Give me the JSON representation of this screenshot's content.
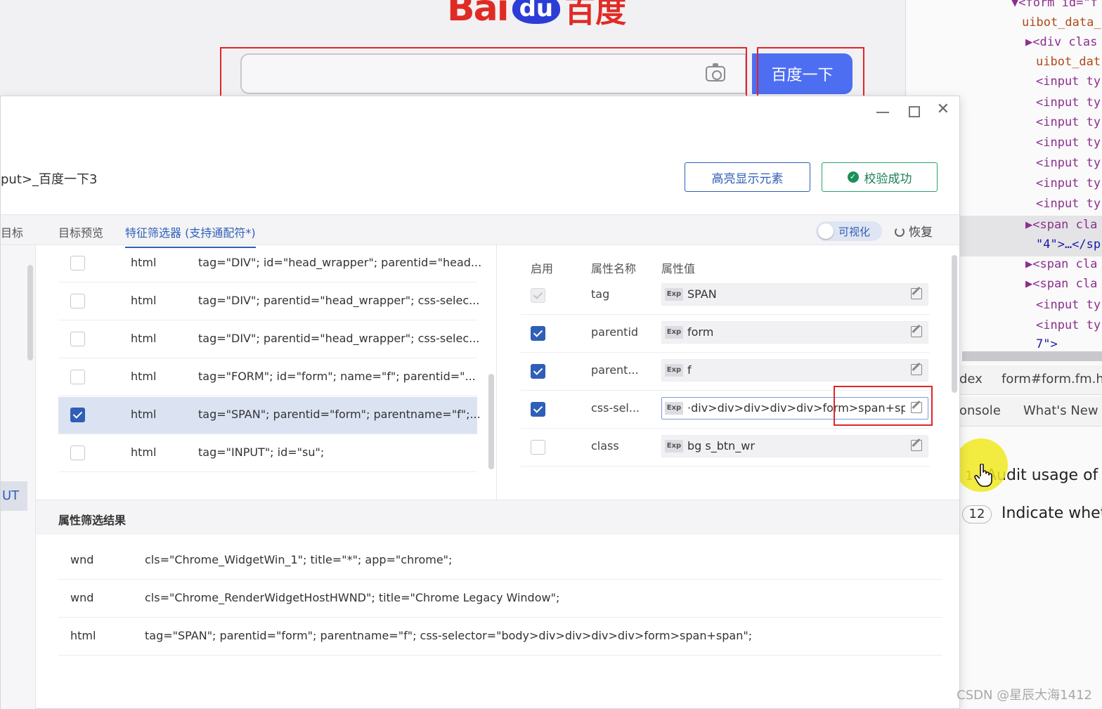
{
  "browser": {
    "logo_bai": "Bai",
    "logo_du": "du",
    "logo_cn": "百度",
    "search_button": "百度一下"
  },
  "devtools": {
    "lines": [
      {
        "text": "▼<form id=\"f",
        "cls": ""
      },
      {
        "text": "uibot_data_",
        "cls": "attr"
      },
      {
        "text": "▶<div clas",
        "cls": ""
      },
      {
        "text": "uibot_dat",
        "cls": "attr"
      },
      {
        "text": "<input ty",
        "cls": ""
      },
      {
        "text": "<input ty",
        "cls": ""
      },
      {
        "text": "<input ty",
        "cls": ""
      },
      {
        "text": "<input ty",
        "cls": ""
      },
      {
        "text": "<input ty",
        "cls": ""
      },
      {
        "text": "<input ty",
        "cls": ""
      },
      {
        "text": "<input ty",
        "cls": ""
      },
      {
        "text": "▶<span cla",
        "cls": ""
      },
      {
        "text": "\"4\">…</sp",
        "cls": "val"
      },
      {
        "text": "▶<span cla",
        "cls": ""
      },
      {
        "text": "▶<span cla",
        "cls": ""
      },
      {
        "text": "<input ty",
        "cls": ""
      },
      {
        "text": "<input ty",
        "cls": ""
      },
      {
        "text": "7\">",
        "cls": "val"
      }
    ],
    "breadcrumb_index": "dex",
    "breadcrumb_form": "form#form.fm.ha",
    "tab_console": "onsole",
    "tab_whats_new": "What's New",
    "issue1_badge": "1",
    "issue1_text": "Audit usage of",
    "issue2_badge": "12",
    "issue2_text": "Indicate wheth"
  },
  "dialog": {
    "breadcrumb": "put>_百度一下3",
    "highlight_button": "高亮显示元素",
    "verify_button": "校验成功",
    "tabs": {
      "target": "目标",
      "preview": "目标预览",
      "filter": "特征筛选器 (支持通配符*)"
    },
    "visualize_label": "可视化",
    "restore_label": "恢复",
    "ut_label": "UT",
    "element_list": [
      {
        "type": "html",
        "desc": "tag=\"DIV\"; id=\"head_wrapper\"; parentid=\"head...",
        "checked": false
      },
      {
        "type": "html",
        "desc": "tag=\"DIV\"; parentid=\"head_wrapper\"; css-selec...",
        "checked": false
      },
      {
        "type": "html",
        "desc": "tag=\"DIV\"; parentid=\"head_wrapper\"; css-selec...",
        "checked": false
      },
      {
        "type": "html",
        "desc": "tag=\"FORM\"; id=\"form\"; name=\"f\"; parentid=\"...",
        "checked": false
      },
      {
        "type": "html",
        "desc": "tag=\"SPAN\"; parentid=\"form\"; parentname=\"f\";...",
        "checked": true
      },
      {
        "type": "html",
        "desc": "tag=\"INPUT\"; id=\"su\";",
        "checked": false
      }
    ],
    "props_header": {
      "enabled": "启用",
      "name": "属性名称",
      "value": "属性值"
    },
    "exp_label": "Exp",
    "properties": [
      {
        "name": "tag",
        "value": "SPAN",
        "state": "dim"
      },
      {
        "name": "parentid",
        "value": "form",
        "state": "on"
      },
      {
        "name": "parent...",
        "value": "f",
        "state": "on"
      },
      {
        "name": "css-sel...",
        "value": "·div>div>div>div>div>form>span+span",
        "state": "on"
      },
      {
        "name": "class",
        "value": "bg s_btn_wr",
        "state": "off"
      }
    ],
    "result_title": "属性筛选结果",
    "results": [
      {
        "type": "wnd",
        "desc": "cls=\"Chrome_WidgetWin_1\"; title=\"*\"; app=\"chrome\";"
      },
      {
        "type": "wnd",
        "desc": "cls=\"Chrome_RenderWidgetHostHWND\"; title=\"Chrome Legacy Window\";"
      },
      {
        "type": "html",
        "desc": "tag=\"SPAN\"; parentid=\"form\"; parentname=\"f\"; css-selector=\"body>div>div>div>div>form>span+span\";"
      }
    ]
  },
  "watermark": "CSDN @星辰大海1412",
  "colors": {
    "accent": "#2f5fb6",
    "baidu_blue": "#4e6ef2",
    "baidu_red": "#e02b24",
    "highlight": "#e0252b",
    "cursor_halo": "#f0e81e"
  }
}
